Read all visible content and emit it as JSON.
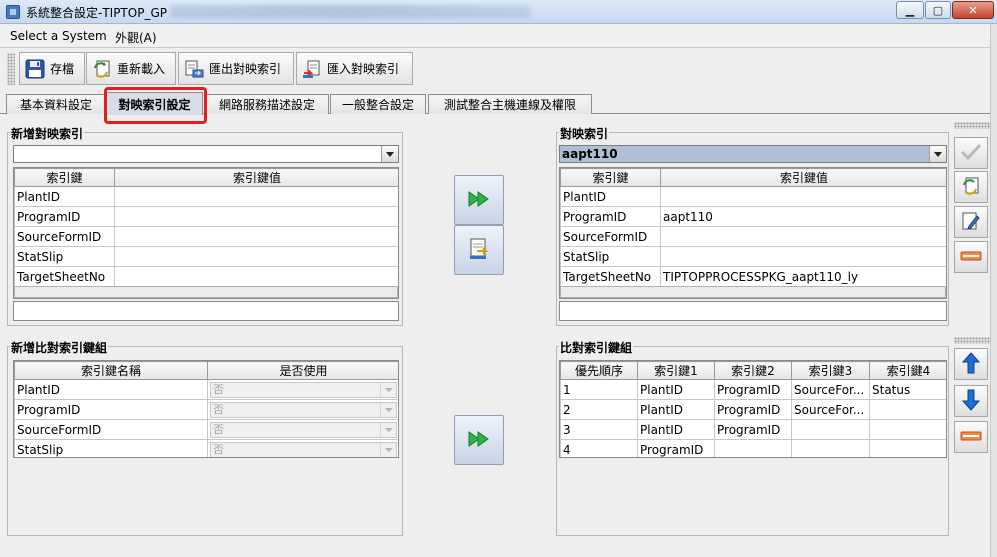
{
  "window": {
    "title": "系統整合設定-TIPTOP_GP",
    "controls": {
      "minimize": "▁",
      "maximize": "▢",
      "close": "✕"
    }
  },
  "menu": {
    "items": [
      "Select a System",
      "外觀(A)"
    ]
  },
  "toolbar": {
    "buttons": [
      {
        "label": "存檔",
        "icon": "floppy-disk-icon"
      },
      {
        "label": "重新載入",
        "icon": "reload-document-icon"
      },
      {
        "label": "匯出對映索引",
        "icon": "export-document-icon"
      },
      {
        "label": "匯入對映索引",
        "icon": "import-document-icon"
      }
    ]
  },
  "tabs": [
    {
      "label": "基本資料設定",
      "active": false
    },
    {
      "label": "對映索引設定",
      "active": true
    },
    {
      "label": "網路服務描述設定",
      "active": false
    },
    {
      "label": "一般整合設定",
      "active": false
    },
    {
      "label": "測試整合主機連線及權限",
      "active": false
    }
  ],
  "new_index": {
    "title": "新增對映索引",
    "combo_value": "",
    "columns": [
      "索引鍵",
      "索引鍵值"
    ],
    "rows": [
      [
        "PlantID",
        ""
      ],
      [
        "ProgramID",
        ""
      ],
      [
        "SourceFormID",
        ""
      ],
      [
        "StatSlip",
        ""
      ],
      [
        "TargetSheetNo",
        ""
      ]
    ],
    "footer_value": ""
  },
  "index_map": {
    "title": "對映索引",
    "combo_value": "aapt110",
    "columns": [
      "索引鍵",
      "索引鍵值"
    ],
    "rows": [
      [
        "PlantID",
        ""
      ],
      [
        "ProgramID",
        "aapt110"
      ],
      [
        "SourceFormID",
        ""
      ],
      [
        "StatSlip",
        ""
      ],
      [
        "TargetSheetNo",
        "TIPTOPPROCESSPKG_aapt110_ly"
      ]
    ],
    "footer_value": ""
  },
  "new_compare": {
    "title": "新增比對索引鍵組",
    "columns": [
      "索引鍵名稱",
      "是否使用"
    ],
    "rows": [
      [
        "PlantID",
        "否"
      ],
      [
        "ProgramID",
        "否"
      ],
      [
        "SourceFormID",
        "否"
      ],
      [
        "StatSlip",
        "否"
      ]
    ]
  },
  "compare_set": {
    "title": "比對索引鍵組",
    "columns": [
      "優先順序",
      "索引鍵1",
      "索引鍵2",
      "索引鍵3",
      "索引鍵4"
    ],
    "rows": [
      [
        "1",
        "PlantID",
        "ProgramID",
        "SourceFor...",
        "Status"
      ],
      [
        "2",
        "PlantID",
        "ProgramID",
        "SourceFor...",
        ""
      ],
      [
        "3",
        "PlantID",
        "ProgramID",
        "",
        ""
      ],
      [
        "4",
        "ProgramID",
        "",
        "",
        ""
      ]
    ]
  },
  "colors": {
    "highlight_red": "#e21f1f",
    "arrow_green": "#2db34a",
    "arrow_blue": "#1f6fd1"
  }
}
